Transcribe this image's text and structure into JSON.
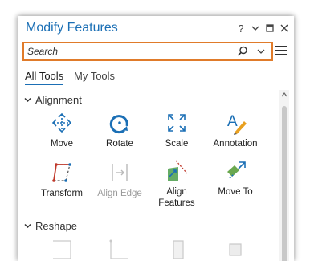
{
  "pane": {
    "title": "Modify Features",
    "controls": {
      "help_label": "?",
      "menu_label": "⌄",
      "maximize_label": "□",
      "close_label": "✕"
    }
  },
  "search": {
    "placeholder": "Search",
    "value": ""
  },
  "tabs": [
    {
      "label": "All Tools",
      "active": true
    },
    {
      "label": "My Tools",
      "active": false
    }
  ],
  "sections": [
    {
      "name": "Alignment",
      "tools": [
        {
          "label": "Move",
          "icon": "move-icon",
          "enabled": true
        },
        {
          "label": "Rotate",
          "icon": "rotate-icon",
          "enabled": true
        },
        {
          "label": "Scale",
          "icon": "scale-icon",
          "enabled": true
        },
        {
          "label": "Annotation",
          "icon": "annotation-icon",
          "enabled": true
        },
        {
          "label": "Transform",
          "icon": "transform-icon",
          "enabled": true
        },
        {
          "label": "Align Edge",
          "icon": "align-edge-icon",
          "enabled": false
        },
        {
          "label": "Align Features",
          "icon": "align-features-icon",
          "enabled": true
        },
        {
          "label": "Move To",
          "icon": "move-to-icon",
          "enabled": true
        }
      ]
    },
    {
      "name": "Reshape",
      "tools": []
    }
  ],
  "colors": {
    "accent": "#1b6fb5",
    "search_border": "#e07b2a"
  }
}
